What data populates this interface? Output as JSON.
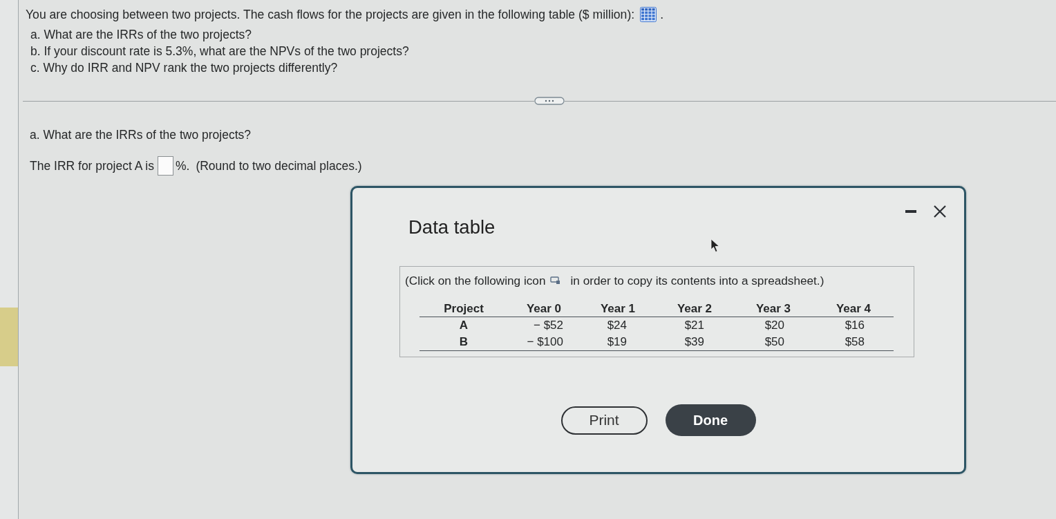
{
  "question": {
    "intro": "You are choosing between two projects. The cash flows for the projects are given in the following table ($ million):",
    "intro_end": ".",
    "parts": [
      "a. What are the IRRs of the two projects?",
      "b. If your discount rate is 5.3%, what are the NPVs of the two projects?",
      "c. Why do IRR and NPV rank the two projects differently?"
    ]
  },
  "answer": {
    "heading": "a. What are the IRRs of the two projects?",
    "prompt": "The IRR for project A is",
    "suffix": "%.",
    "hint": "(Round to two decimal places.)"
  },
  "dialog": {
    "title": "Data table",
    "instruction_before": "(Click on the following icon",
    "instruction_after": "in order to copy its contents into a spreadsheet.)",
    "table": {
      "columns": [
        "Project",
        "Year 0",
        "Year 1",
        "Year 2",
        "Year 3",
        "Year 4"
      ],
      "rows": [
        [
          "A",
          "− $52",
          "$24",
          "$21",
          "$20",
          "$16"
        ],
        [
          "B",
          "− $100",
          "$19",
          "$39",
          "$50",
          "$58"
        ]
      ]
    },
    "buttons": [
      {
        "label": "Print",
        "kind": "outline"
      },
      {
        "label": "Done",
        "kind": "filled"
      }
    ]
  }
}
